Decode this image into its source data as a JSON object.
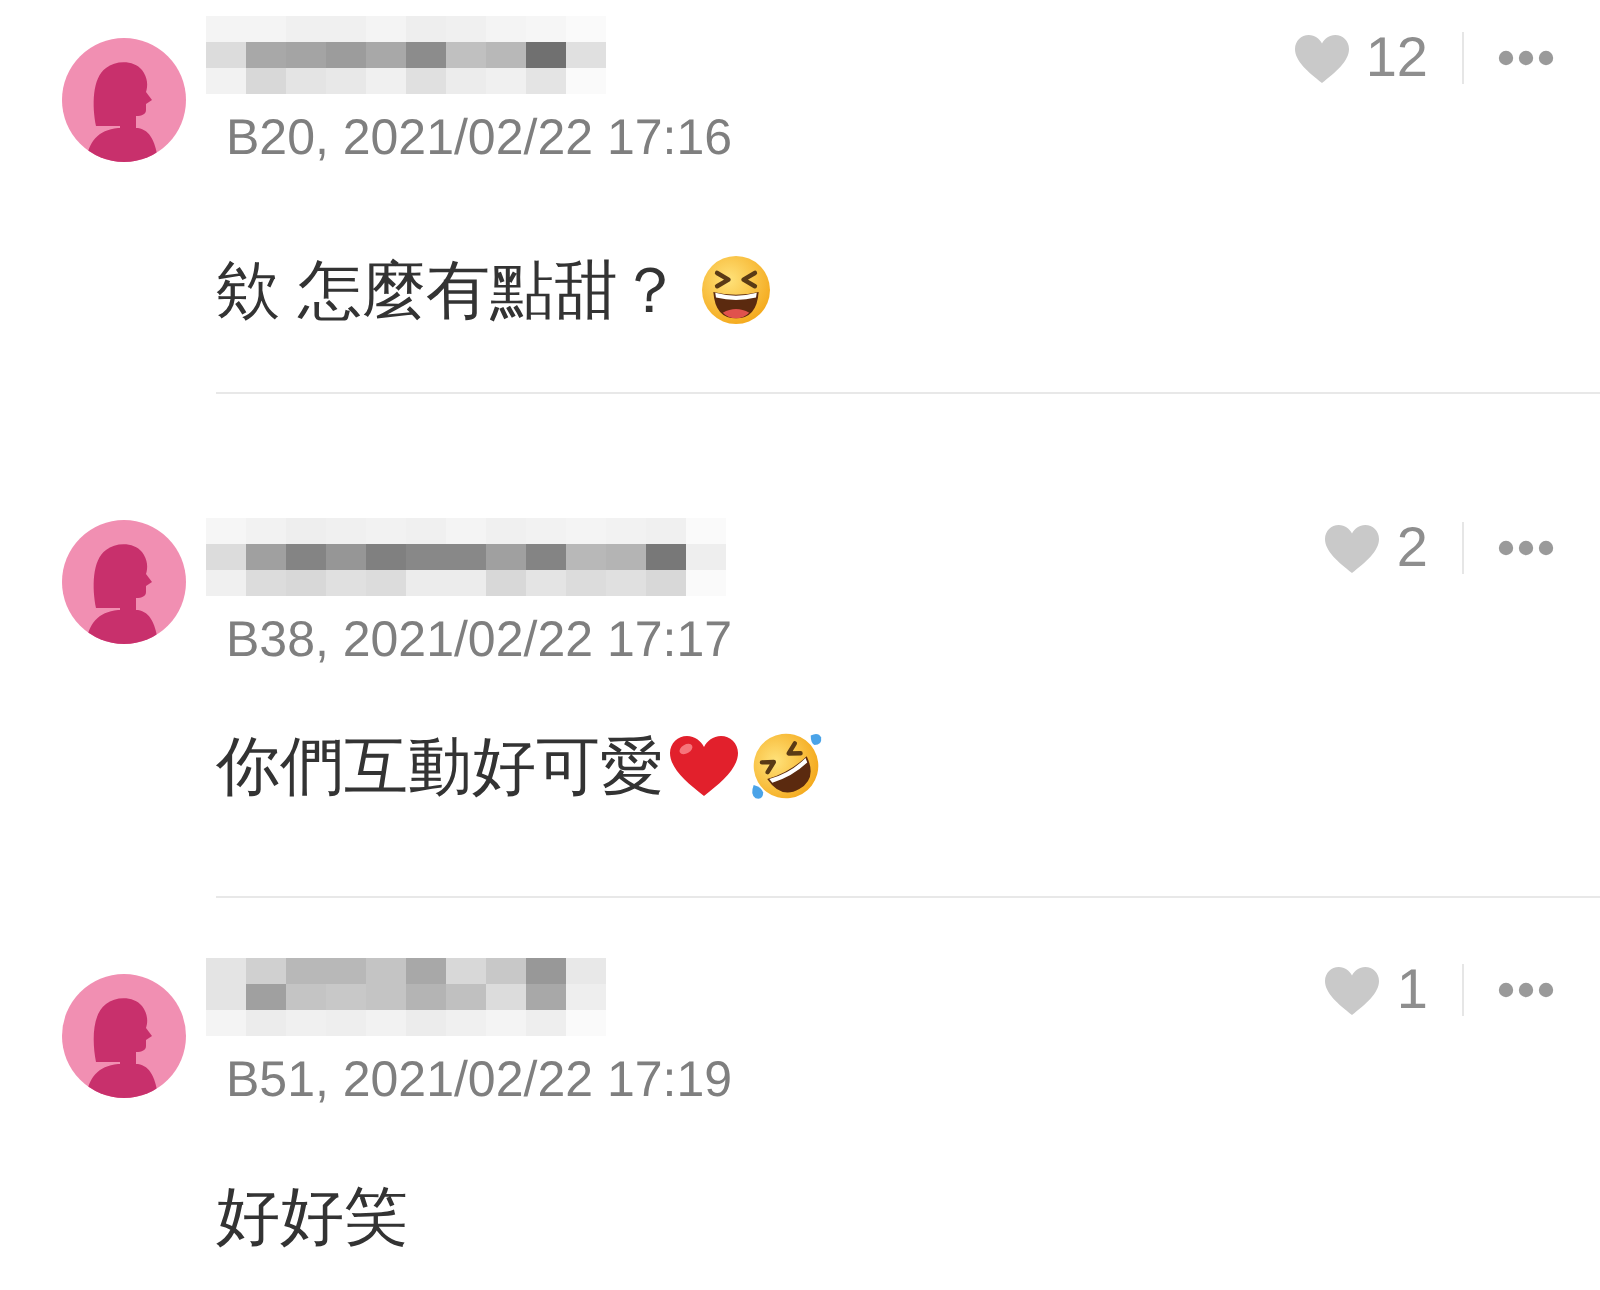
{
  "comments": [
    {
      "meta": "B20, 2021/02/22 17:16",
      "liked": false,
      "like_count": "12",
      "text": "欸 怎麼有點甜？",
      "emojis": [
        {
          "kind": "laughing"
        }
      ]
    },
    {
      "meta": "B38, 2021/02/22 17:17",
      "liked": false,
      "like_count": "2",
      "text": "你們互動好可愛",
      "emojis": [
        {
          "kind": "heart"
        },
        {
          "kind": "rofl"
        }
      ]
    },
    {
      "meta": "B51, 2021/02/22 17:19",
      "liked": false,
      "like_count": "1",
      "text": "好好笑"
    }
  ]
}
